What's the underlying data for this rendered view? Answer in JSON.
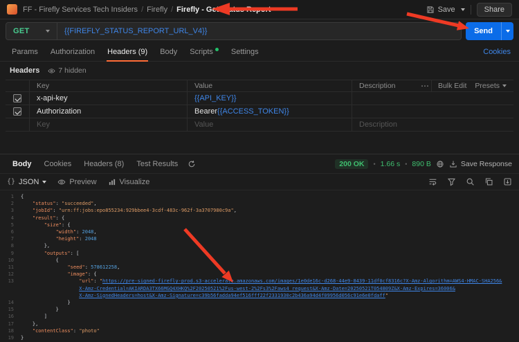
{
  "topbar": {
    "breadcrumb_workspace": "FF - Firefly Services Tech Insiders",
    "breadcrumb_folder": "Firefly",
    "breadcrumb_request": "Firefly - Get Status Report",
    "separator": "/",
    "save_label": "Save",
    "share_label": "Share"
  },
  "request": {
    "method": "GET",
    "url": "{{FIREFLY_STATUS_REPORT_URL_V4}}",
    "send_label": "Send"
  },
  "request_tabs": [
    {
      "label": "Params"
    },
    {
      "label": "Authorization"
    },
    {
      "label": "Headers (9)"
    },
    {
      "label": "Body"
    },
    {
      "label": "Scripts"
    },
    {
      "label": "Settings"
    }
  ],
  "cookies_link": "Cookies",
  "icons": {
    "more": "⋯"
  },
  "headers_section": {
    "title": "Headers",
    "hidden_label": "7 hidden",
    "columns": [
      "Key",
      "Value",
      "Description"
    ],
    "bulk_edit_label": "Bulk Edit",
    "presets_label": "Presets",
    "rows": [
      {
        "key": "x-api-key",
        "value_prefix": "",
        "value_var": "{{API_KEY}}",
        "description": ""
      },
      {
        "key": "Authorization",
        "value_prefix": "Bearer ",
        "value_var": "{{ACCESS_TOKEN}}",
        "description": ""
      }
    ],
    "placeholder_row": {
      "key": "Key",
      "value": "Value",
      "description": "Description"
    }
  },
  "response": {
    "tabs": [
      {
        "label": "Body"
      },
      {
        "label": "Cookies"
      },
      {
        "label": "Headers (8)"
      },
      {
        "label": "Test Results"
      }
    ],
    "status": "200 OK",
    "time": "1.66 s",
    "size": "890 B",
    "meta_sep": "•",
    "save_label": "Save Response",
    "braces": "{}",
    "format": "JSON",
    "preview_label": "Preview",
    "visualize_label": "Visualize",
    "code_lines": [
      {
        "n": "1",
        "seg": [
          [
            "p",
            "{"
          ]
        ]
      },
      {
        "n": "2",
        "seg": [
          [
            "w",
            "    "
          ],
          [
            "k",
            "\"status\""
          ],
          [
            "p",
            ": "
          ],
          [
            "s",
            "\"succeeded\""
          ],
          [
            "p",
            ","
          ]
        ]
      },
      {
        "n": "3",
        "seg": [
          [
            "w",
            "    "
          ],
          [
            "k",
            "\"jobId\""
          ],
          [
            "p",
            ": "
          ],
          [
            "s",
            "\"urn:ff:jobs:epo855234:929bbee4-3cdf-483c-962f-3a3707980c9a\""
          ],
          [
            "p",
            ","
          ]
        ]
      },
      {
        "n": "4",
        "seg": [
          [
            "w",
            "    "
          ],
          [
            "k",
            "\"result\""
          ],
          [
            "p",
            ": {"
          ]
        ]
      },
      {
        "n": "5",
        "seg": [
          [
            "w",
            "        "
          ],
          [
            "k",
            "\"size\""
          ],
          [
            "p",
            ": {"
          ]
        ]
      },
      {
        "n": "6",
        "seg": [
          [
            "w",
            "            "
          ],
          [
            "k",
            "\"width\""
          ],
          [
            "p",
            ": "
          ],
          [
            "n",
            "2048"
          ],
          [
            "p",
            ","
          ]
        ]
      },
      {
        "n": "7",
        "seg": [
          [
            "w",
            "            "
          ],
          [
            "k",
            "\"height\""
          ],
          [
            "p",
            ": "
          ],
          [
            "n",
            "2048"
          ]
        ]
      },
      {
        "n": "8",
        "seg": [
          [
            "w",
            "        "
          ],
          [
            "p",
            "},"
          ]
        ]
      },
      {
        "n": "9",
        "seg": [
          [
            "w",
            "        "
          ],
          [
            "k",
            "\"outputs\""
          ],
          [
            "p",
            ": ["
          ]
        ]
      },
      {
        "n": "10",
        "seg": [
          [
            "w",
            "            "
          ],
          [
            "p",
            "{"
          ]
        ]
      },
      {
        "n": "11",
        "seg": [
          [
            "w",
            "                "
          ],
          [
            "k",
            "\"seed\""
          ],
          [
            "p",
            ": "
          ],
          [
            "n",
            "578612258"
          ],
          [
            "p",
            ","
          ]
        ]
      },
      {
        "n": "12",
        "seg": [
          [
            "w",
            "                "
          ],
          [
            "k",
            "\"image\""
          ],
          [
            "p",
            ": {"
          ]
        ]
      },
      {
        "n": "13",
        "seg": [
          [
            "w",
            "                    "
          ],
          [
            "k",
            "\"url\""
          ],
          [
            "p",
            ": "
          ],
          [
            "s",
            "\""
          ],
          [
            "u",
            "https://pre-signed-firefly-prod.s3-accelerate.amazonaws.com/images/1e0de16c-d268-44e9-8439-11df0cf8316c?X-Amz-Algorithm=AWS4-HMAC-SHA256&"
          ]
        ]
      },
      {
        "n": "",
        "seg": [
          [
            "w",
            "                    "
          ],
          [
            "u",
            "X-Amz-Credential=AKIARDA3TX66MGQ4XHKQ%2F20250521%2Fus-west-2%2Fs3%2Faws4_request&X-Amz-Date=20250521T054809Z&X-Amz-Expires=36006&"
          ]
        ]
      },
      {
        "n": "",
        "seg": [
          [
            "w",
            "                    "
          ],
          [
            "u",
            "X-Amz-SignedHeaders=host&X-Amz-Signature=c39b56fadda94ef516fff22f2331930c2b436a94d4f09956d056c91e6e0fdaff"
          ],
          [
            "s",
            "\""
          ]
        ]
      },
      {
        "n": "14",
        "seg": [
          [
            "w",
            "                "
          ],
          [
            "p",
            "}"
          ]
        ]
      },
      {
        "n": "15",
        "seg": [
          [
            "w",
            "            "
          ],
          [
            "p",
            "}"
          ]
        ]
      },
      {
        "n": "16",
        "seg": [
          [
            "w",
            "        "
          ],
          [
            "p",
            "]"
          ]
        ]
      },
      {
        "n": "17",
        "seg": [
          [
            "w",
            "    "
          ],
          [
            "p",
            "},"
          ]
        ]
      },
      {
        "n": "18",
        "seg": [
          [
            "w",
            "    "
          ],
          [
            "k",
            "\"contentClass\""
          ],
          [
            "p",
            ": "
          ],
          [
            "s",
            "\"photo\""
          ]
        ]
      },
      {
        "n": "19",
        "seg": [
          [
            "p",
            "}"
          ]
        ]
      }
    ]
  }
}
